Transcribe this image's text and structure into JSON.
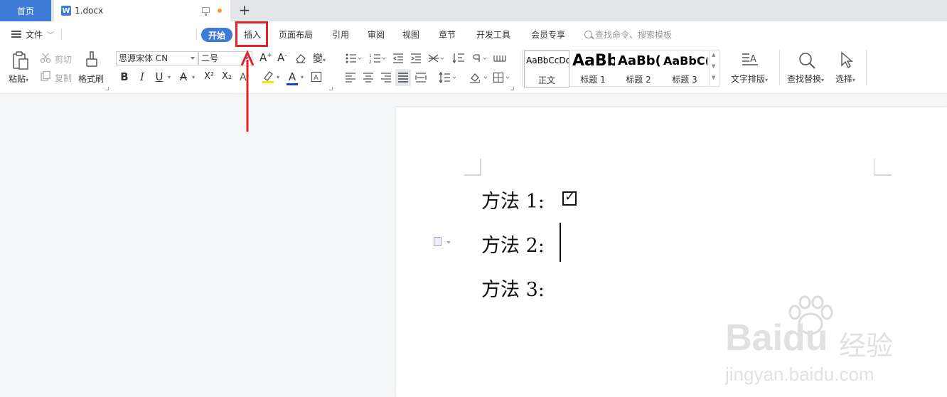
{
  "tabs": {
    "home": "首页",
    "doc_icon": "W",
    "doc_name": "1.docx",
    "new_tab": "+"
  },
  "menu": {
    "file": "文件",
    "start": "开始",
    "insert": "插入",
    "layout": "页面布局",
    "reference": "引用",
    "review": "审阅",
    "view": "视图",
    "section": "章节",
    "devtools": "开发工具",
    "member": "会员专享",
    "search": "查找命令、搜索模板"
  },
  "ribbon": {
    "paste": "粘贴",
    "cut": "剪切",
    "copy": "复制",
    "format_painter": "格式刷",
    "font_name": "思源宋体 CN",
    "font_size": "二号",
    "bold": "B",
    "italic": "I",
    "underline": "U",
    "strike": "A",
    "superscript": "X²",
    "subscript": "X₂",
    "font_color": "A",
    "text_layout": "文字排版",
    "find_replace": "查找替换",
    "select": "选择"
  },
  "styles": [
    {
      "preview": "AaBbCcDd",
      "name": "正文"
    },
    {
      "preview": "AaBb",
      "name": "标题 1"
    },
    {
      "preview": "AaBb(",
      "name": "标题 2"
    },
    {
      "preview": "AaBbC(",
      "name": "标题 3"
    }
  ],
  "document": {
    "line1": "方法 1:",
    "line2": "方法 2:",
    "line3": "方法 3:",
    "checkbox_mark": "✓"
  },
  "watermark": {
    "brand": "Baidu",
    "brand_cn": "经验",
    "url": "jingyan.baidu.com"
  },
  "colors": {
    "accent": "#3d7bd6",
    "highlight": "#e0242b"
  }
}
